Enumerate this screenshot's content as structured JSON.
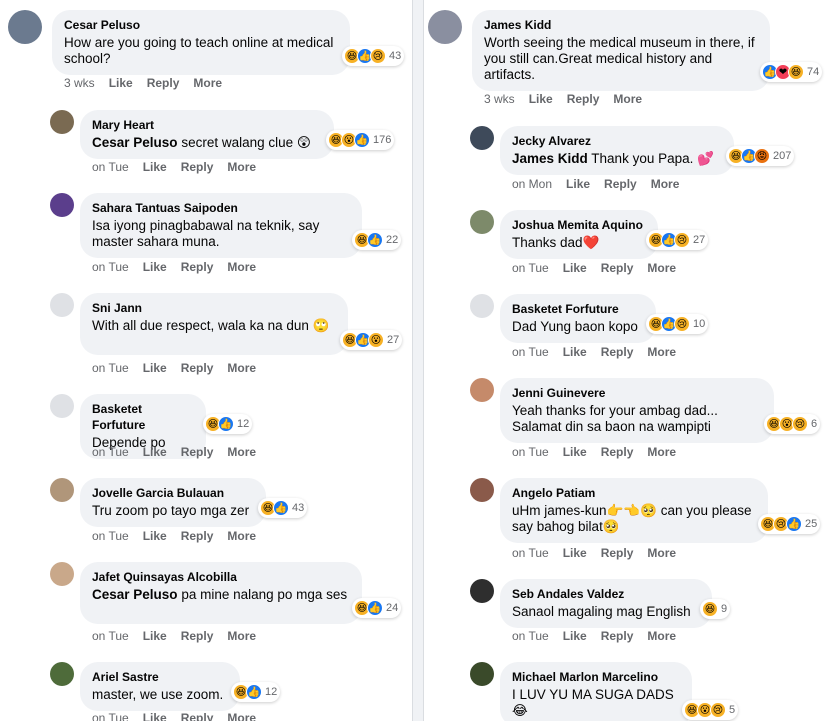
{
  "left": [
    {
      "name": "Cesar Peluso",
      "text": "How are you going to teach online at medical school?",
      "time": "3 wks",
      "count": "43",
      "reacts": [
        "haha",
        "like",
        "sad"
      ],
      "avatar": "#6b7a8f"
    },
    {
      "name": "Mary Heart",
      "mention": "Cesar Peluso",
      "text": "secret walang clue 😲",
      "time": "on Tue",
      "count": "176",
      "reacts": [
        "haha",
        "wow",
        "like"
      ],
      "avatar": "#7a6a52"
    },
    {
      "name": "Sahara Tantuas Saipoden",
      "text": "Isa iyong pinagbabawal na teknik, say master sahara muna.",
      "time": "on Tue",
      "count": "22",
      "reacts": [
        "haha",
        "like"
      ],
      "avatar": "#5b3e8c"
    },
    {
      "name": "Sni Jann",
      "text": "With all due respect, wala ka na dun 🙄",
      "time": "on Tue",
      "count": "27",
      "reacts": [
        "haha",
        "like",
        "wow"
      ],
      "avatar": "#dfe1e5"
    },
    {
      "name": "Basketet Forfuture",
      "text": "Depende po",
      "time": "on Tue",
      "count": "12",
      "reacts": [
        "haha",
        "like"
      ],
      "avatar": "#dfe1e5"
    },
    {
      "name": "Jovelle Garcia Bulauan",
      "text": "Tru zoom po tayo mga zer",
      "time": "on Tue",
      "count": "43",
      "reacts": [
        "haha",
        "like"
      ],
      "avatar": "#b0967a"
    },
    {
      "name": "Jafet Quinsayas Alcobilla",
      "mention": "Cesar Peluso",
      "text": "pa mine nalang po mga ses",
      "time": "on Tue",
      "count": "24",
      "reacts": [
        "haha",
        "like"
      ],
      "avatar": "#c9a88a"
    },
    {
      "name": "Ariel Sastre",
      "text": "master, we use zoom.",
      "time": "on Tue",
      "count": "12",
      "reacts": [
        "haha",
        "like"
      ],
      "avatar": "#4e6b3a"
    }
  ],
  "right": [
    {
      "name": "James Kidd",
      "text": "Worth seeing the medical museum in there, if you still can.Great medical history and artifacts.",
      "time": "3 wks",
      "count": "74",
      "reacts": [
        "like",
        "love",
        "haha"
      ],
      "avatar": "#8a8fa0"
    },
    {
      "name": "Jecky Alvarez",
      "mention": "James Kidd",
      "text": "Thank you Papa. 💕",
      "time": "on Mon",
      "count": "207",
      "reacts": [
        "haha",
        "like",
        "angry"
      ],
      "avatar": "#3e4a5a"
    },
    {
      "name": "Joshua Memita Aquino",
      "text": "Thanks dad❤️",
      "time": "on Tue",
      "count": "27",
      "reacts": [
        "haha",
        "like",
        "sad"
      ],
      "avatar": "#7d8a6a"
    },
    {
      "name": "Basketet Forfuture",
      "text": "Dad Yung baon kopo",
      "time": "on Tue",
      "count": "10",
      "reacts": [
        "haha",
        "like",
        "sad"
      ],
      "avatar": "#dfe1e5"
    },
    {
      "name": "Jenni Guinevere",
      "text": "Yeah thanks for your ambag dad... Salamat din sa baon na wampipti",
      "time": "on Tue",
      "count": "6",
      "reacts": [
        "haha",
        "wow",
        "sad"
      ],
      "avatar": "#c58a6a"
    },
    {
      "name": "Angelo Patiam",
      "text": "uHm james-kun👉👈🥺 can you please say bahog bilat🥺",
      "time": "on Tue",
      "count": "25",
      "reacts": [
        "haha",
        "sad",
        "like"
      ],
      "avatar": "#8a5a4a"
    },
    {
      "name": "Seb Andales Valdez",
      "text": "Sanaol magaling mag English",
      "time": "on Tue",
      "count": "9",
      "reacts": [
        "haha"
      ],
      "avatar": "#2e2e2e"
    },
    {
      "name": "Michael Marlon Marcelino",
      "text": "I LUV YU MA SUGA DADS 😂",
      "time": "on Tue",
      "count": "5",
      "reacts": [
        "haha",
        "wow",
        "sad"
      ],
      "avatar": "#3a4a2a"
    }
  ],
  "actions": {
    "like": "Like",
    "reply": "Reply",
    "more": "More"
  },
  "icons": {
    "haha": "😆",
    "like": "👍",
    "sad": "😢",
    "wow": "😮",
    "love": "❤",
    "angry": "😡"
  }
}
